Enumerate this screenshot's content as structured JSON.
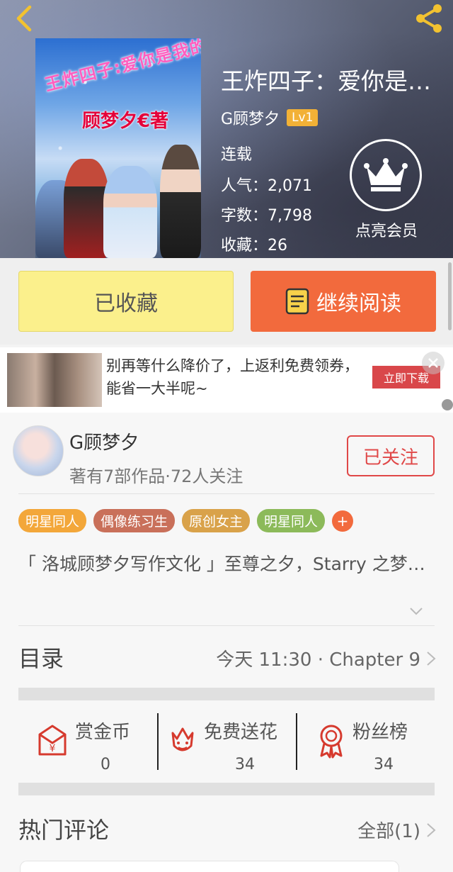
{
  "header": {
    "back_icon": "chevron-left-icon",
    "share_icon": "share-icon",
    "book_title": "王炸四子：爱你是…",
    "author": "G顾梦夕",
    "level": "Lv1",
    "status": "连载",
    "popularity": "人气：2,071",
    "word_count": "字数：7,798",
    "favorites": "收藏：26",
    "vip_label": "点亮会员",
    "cover": {
      "arc_text": "王炸四子:爱你是我的使命",
      "author_text": "顾梦夕€著"
    },
    "colors": {
      "level_badge": "#f2b136"
    }
  },
  "actions": {
    "favorite_label": "已收藏",
    "read_label": "继续阅读",
    "colors": {
      "favorite": "#fbf08c",
      "read": "#f26a3d"
    }
  },
  "ad": {
    "text": "别再等什么降价了，上返利免费领券，能省一大半呢~",
    "button": "立即下载"
  },
  "author_card": {
    "name": "G顾梦夕",
    "stats": "著有7部作品·72人关注",
    "follow_label": "已关注"
  },
  "tags": [
    {
      "label": "明星同人",
      "color": "#f3a73a"
    },
    {
      "label": "偶像练习生",
      "color": "#c9705a"
    },
    {
      "label": "原创女主",
      "color": "#d9a24a"
    },
    {
      "label": "明星同人",
      "color": "#8cba5a"
    }
  ],
  "intro": "「 洛城顾梦夕写作文化 」至尊之夕，Starry 之梦…",
  "catalog": {
    "label": "目录",
    "latest": "今天 11:30 · Chapter 9"
  },
  "stats": [
    {
      "label": "赏金币",
      "value": "0",
      "icon": "red-envelope-icon"
    },
    {
      "label": "免费送花",
      "value": "34",
      "icon": "flower-icon"
    },
    {
      "label": "粉丝榜",
      "value": "34",
      "icon": "medal-icon"
    }
  ],
  "comments": {
    "label": "热门评论",
    "all_label": "全部(1)"
  }
}
